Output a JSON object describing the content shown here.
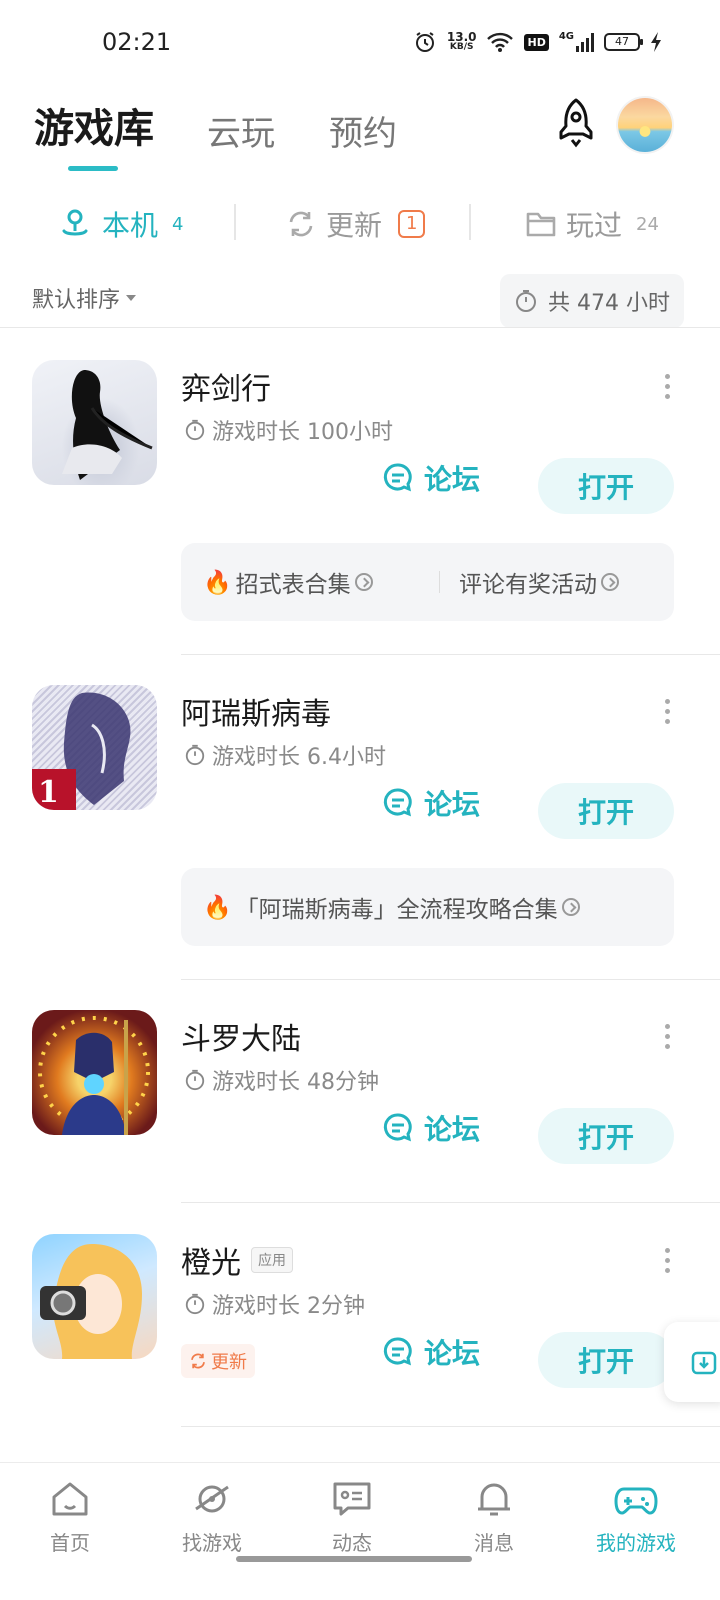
{
  "status_bar": {
    "time": "02:21",
    "net_speed": "13.0",
    "net_unit": "KB/S",
    "hd": "HD",
    "network": "4G",
    "battery": "47"
  },
  "header": {
    "tabs": [
      {
        "label": "游戏库",
        "active": true
      },
      {
        "label": "云玩"
      },
      {
        "label": "预约"
      }
    ],
    "icons": [
      "rocket-icon",
      "avatar"
    ]
  },
  "sub_tabs": {
    "local": {
      "label": "本机",
      "count": "4",
      "icon": "phone-pin-icon"
    },
    "update": {
      "label": "更新",
      "count": "1",
      "icon": "refresh-icon"
    },
    "played": {
      "label": "玩过",
      "count": "24",
      "icon": "folder-icon"
    }
  },
  "sort": {
    "label": "默认排序",
    "total": "共 474 小时"
  },
  "games": [
    {
      "name": "弈剑行",
      "playtime": "游戏时长 100小时",
      "forum": "论坛",
      "open": "打开",
      "promos": [
        "招式表合集",
        "评论有奖活动"
      ]
    },
    {
      "name": "阿瑞斯病毒",
      "playtime": "游戏时长 6.4小时",
      "forum": "论坛",
      "open": "打开",
      "promos": [
        "「阿瑞斯病毒」全流程攻略合集"
      ],
      "icon_badge": "1"
    },
    {
      "name": "斗罗大陆",
      "playtime": "游戏时长 48分钟",
      "forum": "论坛",
      "open": "打开"
    },
    {
      "name": "橙光",
      "tag": "应用",
      "playtime": "游戏时长 2分钟",
      "forum": "论坛",
      "open": "打开",
      "update_label": "更新"
    }
  ],
  "bottom_nav": [
    {
      "label": "首页",
      "icon": "home-icon"
    },
    {
      "label": "找游戏",
      "icon": "planet-icon"
    },
    {
      "label": "动态",
      "icon": "chat-card-icon"
    },
    {
      "label": "消息",
      "icon": "bell-icon"
    },
    {
      "label": "我的游戏",
      "icon": "gamepad-icon",
      "active": true
    }
  ],
  "colors": {
    "accent": "#24b3bf",
    "update": "#f07b4a"
  }
}
